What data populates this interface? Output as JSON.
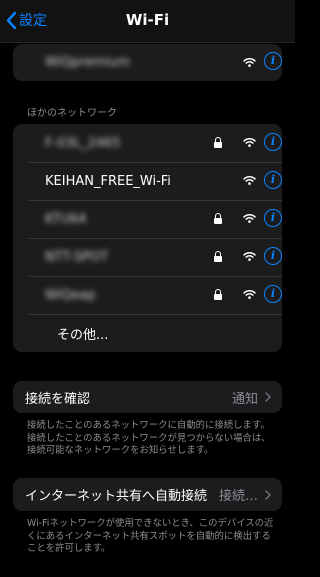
{
  "navbar": {
    "back_label": "設定",
    "title": "Wi-Fi"
  },
  "top_group": {
    "network": {
      "name": "WiQpremium",
      "blurred": true,
      "locked": false
    }
  },
  "other_networks": {
    "header": "ほかのネットワーク",
    "networks": [
      {
        "name": "F-03L_2465",
        "blurred": true,
        "locked": true
      },
      {
        "name": "KEIHAN_FREE_Wi-Fi",
        "blurred": false,
        "locked": false
      },
      {
        "name": "KTU64",
        "blurred": true,
        "locked": true
      },
      {
        "name": "NTT-SPOT",
        "blurred": true,
        "locked": true
      },
      {
        "name": "WiQeap",
        "blurred": true,
        "locked": true
      }
    ],
    "other_label": "その他..."
  },
  "ask_to_join": {
    "label": "接続を確認",
    "value": "通知",
    "footer": "接続したことのあるネットワークに自動的に接続します。接続したことのあるネットワークが見つからない場合は、接続可能なネットワークをお知らせします。"
  },
  "auto_join_hotspot": {
    "label": "インターネット共有へ自動接続",
    "value": "接続…",
    "footer": "Wi-Fiネットワークが使用できないとき、このデバイスの近くにあるインターネット共有スポットを自動的に検出することを許可します。"
  },
  "colors": {
    "accent": "#0a84ff",
    "background": "#000000",
    "cell": "#1c1c1e",
    "secondary_text": "#8d8d93"
  },
  "icons": [
    "chevron-left-icon",
    "lock-icon",
    "wifi-icon",
    "info-icon",
    "chevron-right-icon"
  ]
}
